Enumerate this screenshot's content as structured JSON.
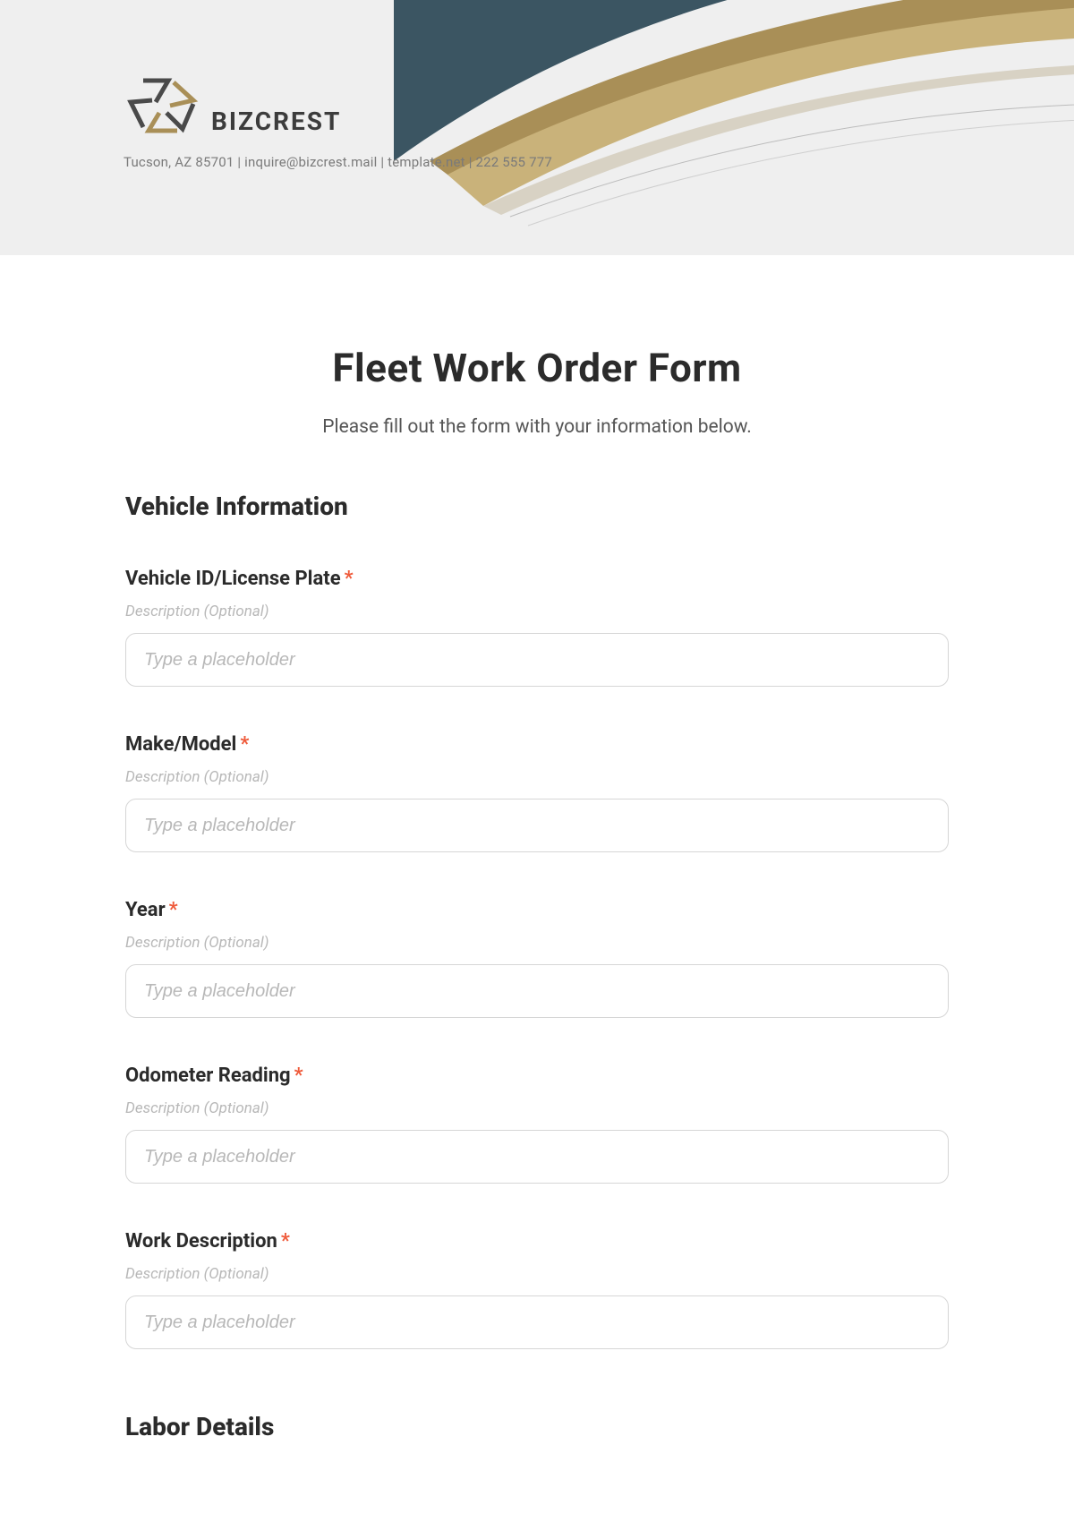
{
  "brand": {
    "name": "BIZCREST",
    "subline": "Tucson, AZ 85701 | inquire@bizcrest.mail | template.net | 222 555 777"
  },
  "form": {
    "title": "Fleet Work Order Form",
    "subtitle": "Please fill out the form with your information below.",
    "section1": "Vehicle Information",
    "section2": "Labor Details",
    "desc_placeholder": "Description (Optional)",
    "input_placeholder": "Type a placeholder",
    "fields": {
      "vehicle_id": {
        "label": "Vehicle ID/License Plate"
      },
      "make_model": {
        "label": "Make/Model"
      },
      "year": {
        "label": "Year"
      },
      "odometer": {
        "label": "Odometer Reading"
      },
      "work_desc": {
        "label": "Work Description"
      }
    }
  },
  "colors": {
    "accent_gold": "#a98f57",
    "accent_gold_light": "#c9b27a",
    "accent_navy": "#3b5562",
    "required": "#ef5a3a"
  }
}
